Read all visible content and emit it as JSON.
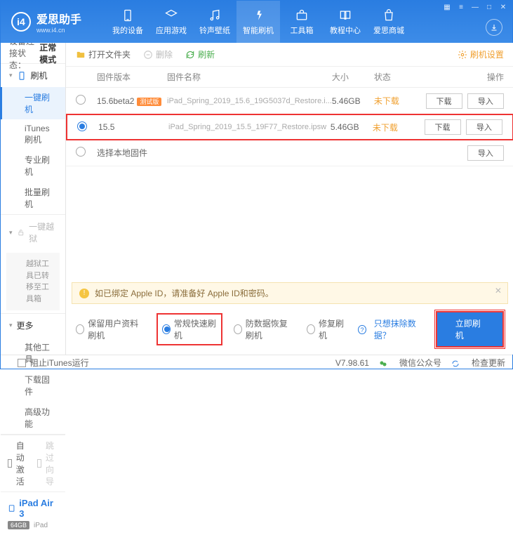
{
  "app": {
    "name_cn": "爱思助手",
    "name_en": "www.i4.cn"
  },
  "nav": [
    {
      "label": "我的设备"
    },
    {
      "label": "应用游戏"
    },
    {
      "label": "铃声壁纸"
    },
    {
      "label": "智能刷机"
    },
    {
      "label": "工具箱"
    },
    {
      "label": "教程中心"
    },
    {
      "label": "爱思商城"
    }
  ],
  "conn": {
    "label": "设备连接状态：",
    "value": "正常模式"
  },
  "sidebar": {
    "flash": {
      "title": "刷机",
      "items": [
        "一键刷机",
        "iTunes刷机",
        "专业刷机",
        "批量刷机"
      ]
    },
    "jailbreak": {
      "title": "一键越狱",
      "note": "越狱工具已转移至工具箱"
    },
    "more": {
      "title": "更多",
      "items": [
        "其他工具",
        "下载固件",
        "高级功能"
      ]
    },
    "auto_activate": "自动激活",
    "skip_guide": "跳过向导"
  },
  "device": {
    "name": "iPad Air 3",
    "storage": "64GB",
    "type": "iPad"
  },
  "block_itunes": "阻止iTunes运行",
  "toolbar": {
    "open": "打开文件夹",
    "delete": "删除",
    "refresh": "刷新",
    "settings": "刷机设置"
  },
  "cols": {
    "ver": "固件版本",
    "name": "固件名称",
    "size": "大小",
    "status": "状态",
    "ops": "操作"
  },
  "rows": [
    {
      "ver": "15.6beta2",
      "beta": "测试版",
      "name": "iPad_Spring_2019_15.6_19G5037d_Restore.i...",
      "size": "5.46GB",
      "status": "未下载",
      "sel": false
    },
    {
      "ver": "15.5",
      "name": "iPad_Spring_2019_15.5_19F77_Restore.ipsw",
      "size": "5.46GB",
      "status": "未下载",
      "sel": true
    }
  ],
  "local_fw": "选择本地固件",
  "btn": {
    "download": "下载",
    "import": "导入"
  },
  "alert": "如已绑定 Apple ID，请准备好 Apple ID和密码。",
  "modes": {
    "keep": "保留用户资料刷机",
    "normal": "常规快速刷机",
    "recover": "防数据恢复刷机",
    "repair": "修复刷机"
  },
  "exclude_link": "只想抹除数据？",
  "flash_now": "立即刷机",
  "footer": {
    "version": "V7.98.61",
    "wechat": "微信公众号",
    "update": "检查更新"
  }
}
